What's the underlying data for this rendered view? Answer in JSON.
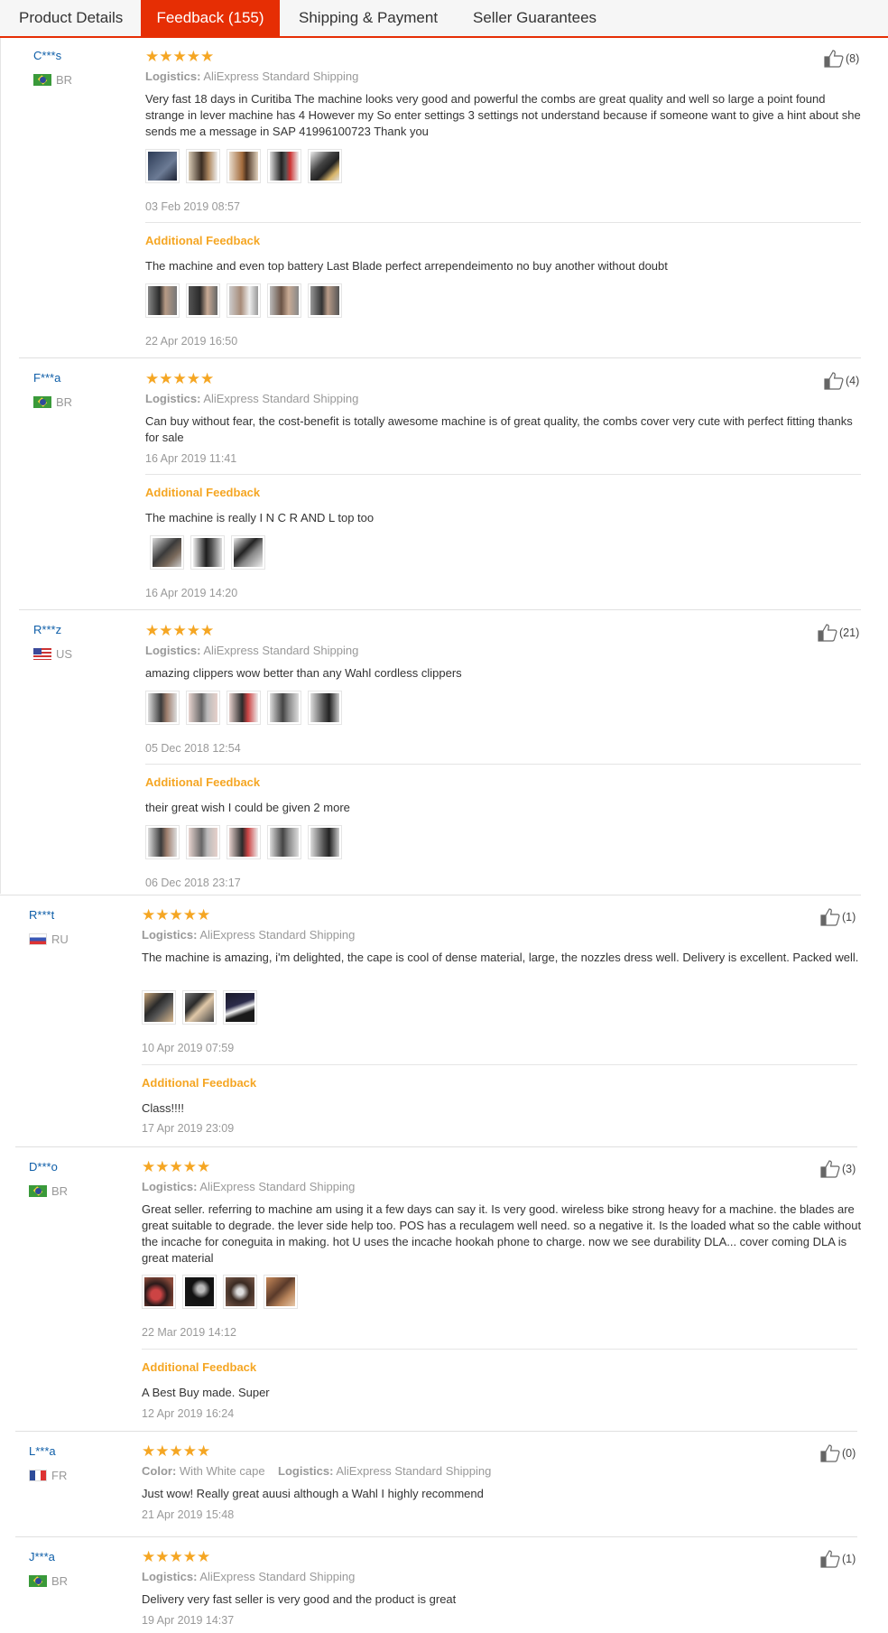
{
  "tabs": [
    {
      "label": "Product Details",
      "active": false
    },
    {
      "label": "Feedback (155)",
      "active": true
    },
    {
      "label": "Shipping & Payment",
      "active": false
    },
    {
      "label": "Seller Guarantees",
      "active": false
    }
  ],
  "logistics_label": "Logistics:",
  "logistics_value": "AliExpress Standard Shipping",
  "color_label": "Color:",
  "additional_title": "Additional Feedback",
  "rating_stars": "★★★★★",
  "reviews": [
    {
      "user": "C***s",
      "country": "BR",
      "likes": "(8)",
      "text": "Very fast 18 days in Curitiba The machine looks very good and powerful the combs are great quality and well so large a point found strange in lever machine has 4 However my So enter settings 3 settings not understand because if someone want to give a hint about she sends me a message in SAP 41996100723 Thank you",
      "date": "03 Feb 2019 08:57",
      "additional_text": "The machine and even top battery Last Blade perfect arrependeimento no buy another without doubt",
      "additional_date": "22 Apr 2019 16:50"
    },
    {
      "user": "F***a",
      "country": "BR",
      "likes": "(4)",
      "text": "Can buy without fear, the cost-benefit is totally awesome machine is of great quality, the combs cover very cute with perfect fitting thanks for sale",
      "date": "16 Apr 2019 11:41",
      "additional_text": "The machine is really I N C R AND L top too",
      "additional_date": "16 Apr 2019 14:20"
    },
    {
      "user": "R***z",
      "country": "US",
      "likes": "(21)",
      "text": "amazing clippers wow better than any Wahl cordless clippers",
      "date": "05 Dec 2018 12:54",
      "additional_text": "their great wish I could be given 2 more",
      "additional_date": "06 Dec 2018 23:17"
    },
    {
      "user": "R***t",
      "country": "RU",
      "likes": "(1)",
      "text": "The machine is amazing, i'm delighted, the cape is cool of dense material, large, the nozzles dress well. Delivery is excellent. Packed well.",
      "date": "10 Apr 2019 07:59",
      "additional_text": "Class!!!!",
      "additional_date": "17 Apr 2019 23:09"
    },
    {
      "user": "D***o",
      "country": "BR",
      "likes": "(3)",
      "text": "Great seller. referring to machine am using it a few days can say it. Is very good. wireless bike strong heavy for a machine. the blades are great suitable to degrade. the lever side help too. POS has a reculagem well need. so a negative it. Is the loaded what so the cable without the incache for coneguita in making. hot U uses the incache hookah phone to charge. now we see durability DLA... cover coming DLA is great material",
      "date": "22 Mar 2019 14:12",
      "additional_text": "A Best Buy made. Super",
      "additional_date": "12 Apr 2019 16:24"
    },
    {
      "user": "L***a",
      "country": "FR",
      "likes": "(0)",
      "color_value": "With White cape",
      "text": "Just wow! Really great auusi although a Wahl I highly recommend",
      "date": "21 Apr 2019 15:48"
    },
    {
      "user": "J***a",
      "country": "BR",
      "likes": "(1)",
      "text": "Delivery very fast seller is very good and the product is great",
      "date": "19 Apr 2019 14:37"
    }
  ],
  "colors": {
    "accent": "#e62e04",
    "star": "#f5a623",
    "username": "#0e5ea8",
    "meta": "#999999"
  },
  "icons": [
    "thumbs-up-icon",
    "star-icon",
    "flag-icon"
  ]
}
